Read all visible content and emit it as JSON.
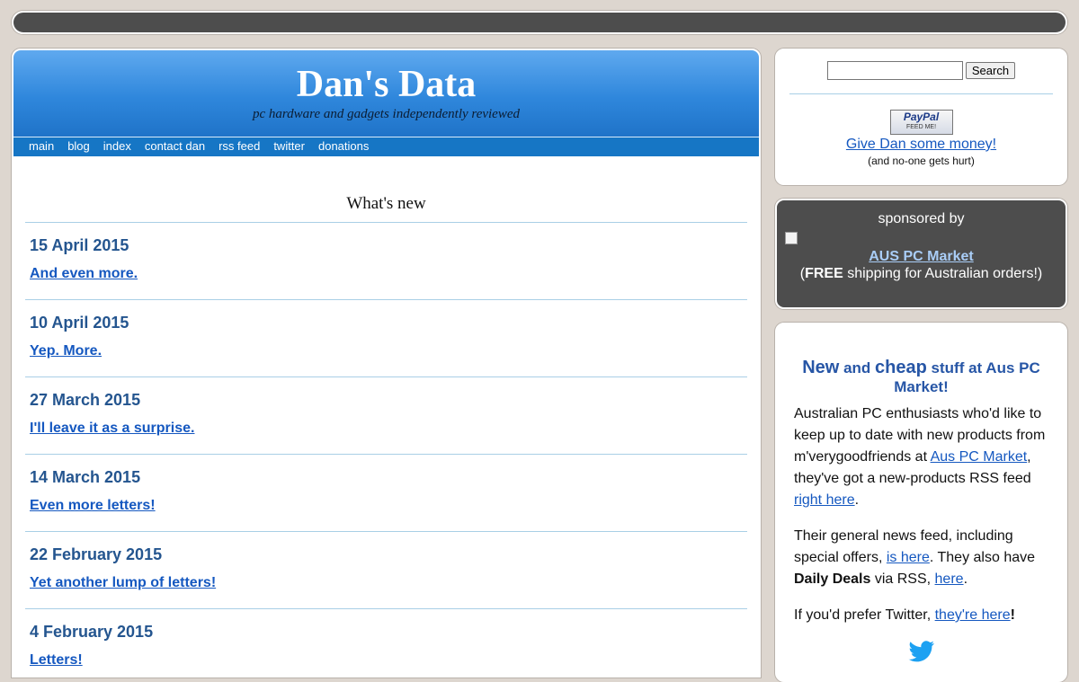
{
  "site": {
    "title": "Dan's Data",
    "tagline": "pc hardware and gadgets independently reviewed"
  },
  "nav": [
    {
      "label": "main"
    },
    {
      "label": "blog"
    },
    {
      "label": "index"
    },
    {
      "label": "contact dan"
    },
    {
      "label": "rss feed"
    },
    {
      "label": "twitter"
    },
    {
      "label": "donations"
    }
  ],
  "whats_new": {
    "heading": "What's new",
    "entries": [
      {
        "date": "15 April 2015",
        "link": "And even more."
      },
      {
        "date": "10 April 2015",
        "link": "Yep. More."
      },
      {
        "date": "27 March 2015",
        "link": "I'll leave it as a surprise."
      },
      {
        "date": "14 March 2015",
        "link": "Even more letters!"
      },
      {
        "date": "22 February 2015",
        "link": "Yet another lump of letters!"
      },
      {
        "date": "4 February 2015",
        "link": "Letters!"
      }
    ]
  },
  "search": {
    "input_value": "",
    "button_label": "Search"
  },
  "donate": {
    "paypal_text": "PayPal",
    "paypal_sub": "FEED ME!",
    "link": "Give Dan some money!",
    "note": "(and no-one gets hurt)"
  },
  "sponsor": {
    "title": "sponsored by",
    "link": "AUS PC Market",
    "note_open": "(",
    "note_bold": "FREE",
    "note_rest": " shipping for Australian orders!)"
  },
  "aus": {
    "heading_new": "New",
    "heading_and": " and ",
    "heading_cheap": "cheap",
    "heading_rest": " stuff at Aus PC Market!",
    "p1_a": "Australian PC enthusiasts who'd like to keep up to date with new products from m'verygoodfriends at ",
    "p1_link1": "Aus PC Market",
    "p1_b": ", they've got a new-products RSS feed ",
    "p1_link2": "right here",
    "p1_c": ".",
    "p2_a": "Their general news feed, including special offers, ",
    "p2_link1": "is here",
    "p2_b": ". They also have ",
    "p2_bold": "Daily Deals",
    "p2_c": " via RSS, ",
    "p2_link2": "here",
    "p2_d": ".",
    "p3_a": "If you'd prefer Twitter, ",
    "p3_link": "they're here",
    "p3_b": "!"
  },
  "colors": {
    "accent": "#1676c5",
    "link": "#1558c0",
    "date_heading": "#24558f",
    "page_bg": "#ddd6cf",
    "dark_box": "#4d4d4d"
  },
  "icons": {
    "twitter": "twitter-bird-icon",
    "broken_image": "broken-image-icon"
  }
}
